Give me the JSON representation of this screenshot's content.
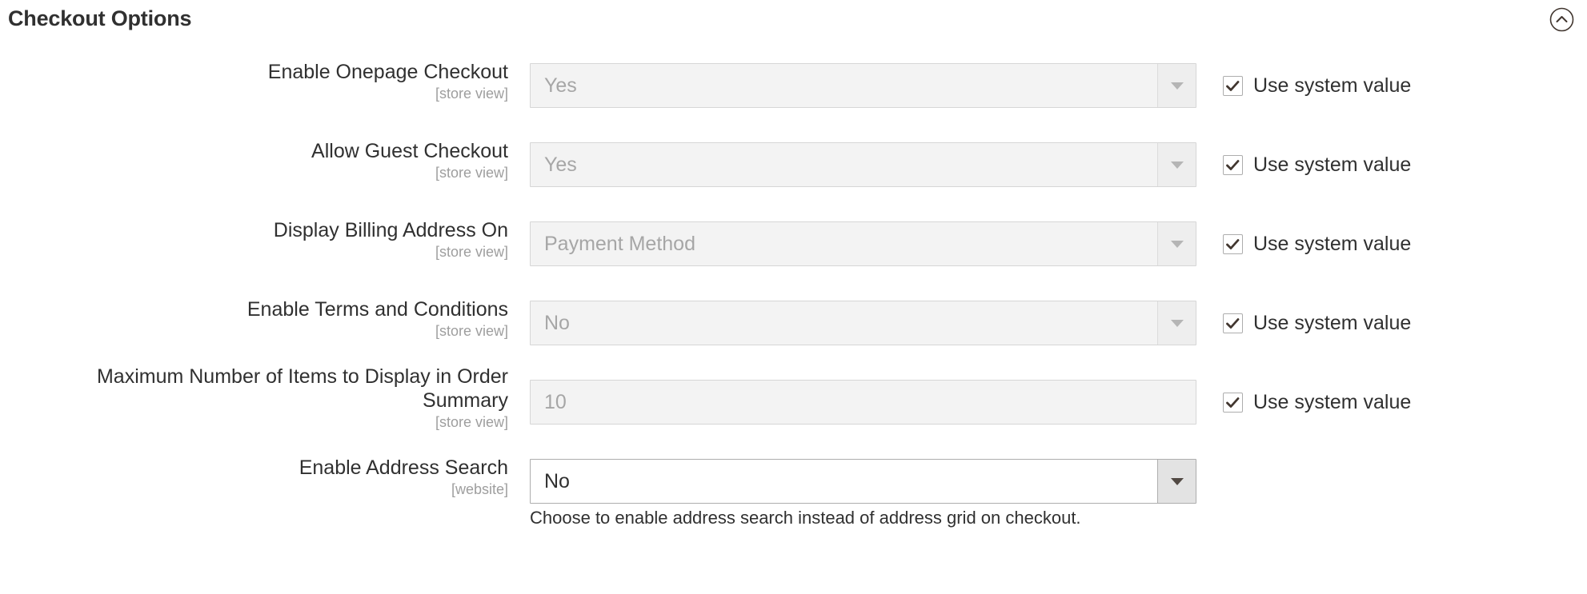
{
  "section": {
    "title": "Checkout Options",
    "collapse_icon": "chevron-up-circle-icon"
  },
  "system_value": {
    "label": "Use system value",
    "checked": true,
    "check_icon": "check-icon"
  },
  "colors": {
    "text": "#303030",
    "muted_text": "#a6a6a6",
    "scope_text": "#9e9e9e",
    "disabled_field_bg": "#f3f3f3",
    "disabled_field_border": "#d6d6d6",
    "active_field_bg": "#ffffff",
    "active_field_border": "#adadad",
    "active_arrow_bg": "#e3e3e3"
  },
  "fields": [
    {
      "label": "Enable Onepage Checkout",
      "scope": "[store view]",
      "control": "select",
      "value": "Yes",
      "disabled": true,
      "arrow_icon": "chevron-down-icon",
      "use_system_value": true,
      "note": ""
    },
    {
      "label": "Allow Guest Checkout",
      "scope": "[store view]",
      "control": "select",
      "value": "Yes",
      "disabled": true,
      "arrow_icon": "chevron-down-icon",
      "use_system_value": true,
      "note": ""
    },
    {
      "label": "Display Billing Address On",
      "scope": "[store view]",
      "control": "select",
      "value": "Payment Method",
      "disabled": true,
      "arrow_icon": "chevron-down-icon",
      "use_system_value": true,
      "note": ""
    },
    {
      "label": "Enable Terms and Conditions",
      "scope": "[store view]",
      "control": "select",
      "value": "No",
      "disabled": true,
      "arrow_icon": "chevron-down-icon",
      "use_system_value": true,
      "note": ""
    },
    {
      "label": "Maximum Number of Items to Display in Order Summary",
      "scope": "[store view]",
      "control": "text",
      "value": "10",
      "disabled": true,
      "arrow_icon": "",
      "use_system_value": true,
      "note": ""
    },
    {
      "label": "Enable Address Search",
      "scope": "[website]",
      "control": "select",
      "value": "No",
      "disabled": false,
      "arrow_icon": "chevron-down-icon",
      "use_system_value": false,
      "note": "Choose to enable address search instead of address grid on checkout."
    }
  ]
}
